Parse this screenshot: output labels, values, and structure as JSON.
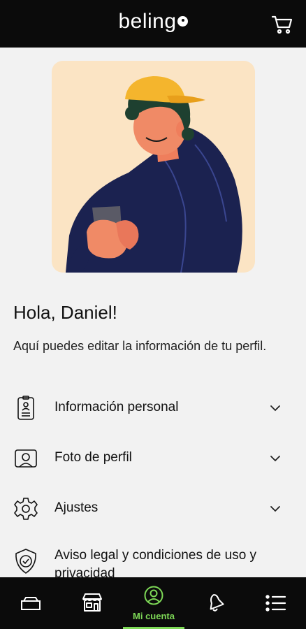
{
  "header": {
    "logo_text": "belingo",
    "cart_icon": "cart-icon"
  },
  "profile": {
    "greeting": "Hola, Daniel!",
    "description": "Aquí puedes editar la información de tu perfil."
  },
  "menu": {
    "items": [
      {
        "label": "Información personal",
        "icon": "id-badge-icon"
      },
      {
        "label": "Foto de perfil",
        "icon": "profile-photo-icon"
      },
      {
        "label": "Ajustes",
        "icon": "gear-icon"
      },
      {
        "label": "Aviso legal y condiciones de uso y privacidad",
        "icon": "shield-check-icon"
      }
    ]
  },
  "bottom_nav": {
    "tabs": [
      {
        "icon": "ticket-icon",
        "label": ""
      },
      {
        "icon": "store-icon",
        "label": ""
      },
      {
        "icon": "account-icon",
        "label": "Mi cuenta",
        "active": true
      },
      {
        "icon": "bell-icon",
        "label": ""
      },
      {
        "icon": "menu-list-icon",
        "label": ""
      }
    ]
  },
  "colors": {
    "bar_background": "#0b0b0b",
    "page_background": "#f2f2f2",
    "accent": "#7ed957",
    "hero_background": "#fbe4c4"
  }
}
